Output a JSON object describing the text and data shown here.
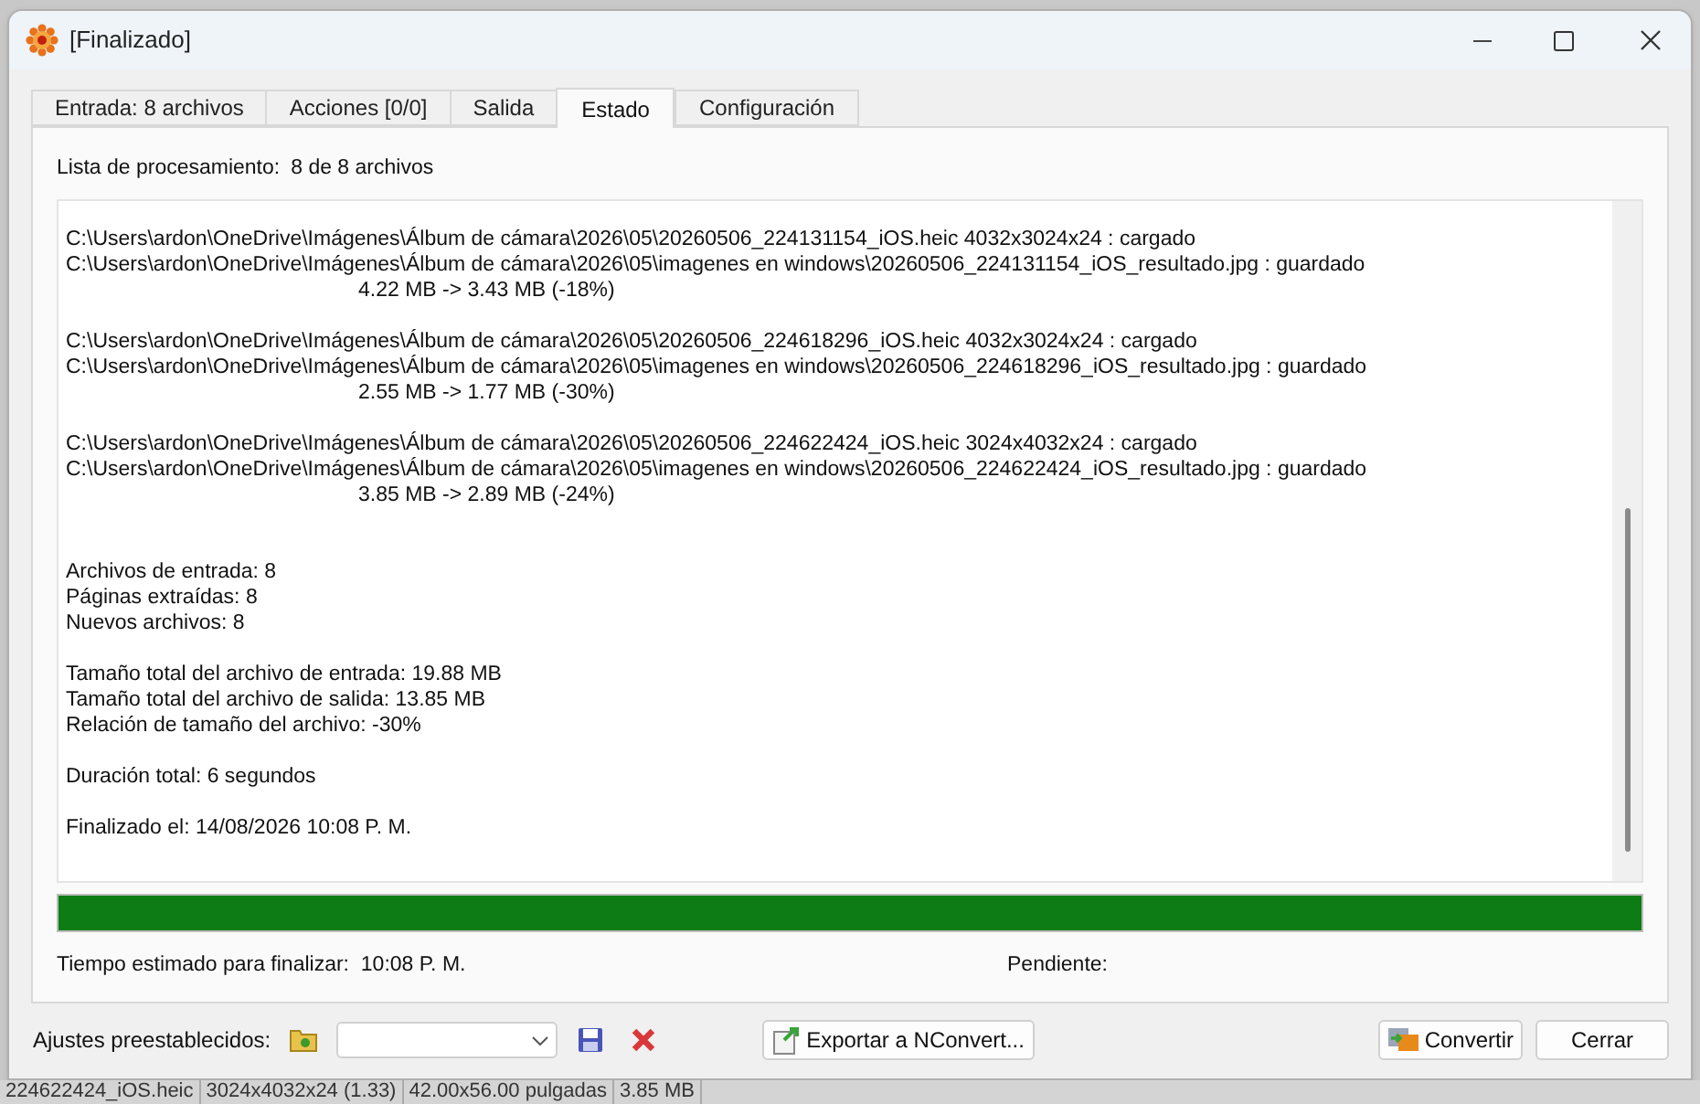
{
  "window": {
    "title": "[Finalizado]"
  },
  "tabs": [
    {
      "label": "Entrada: 8 archivos",
      "selected": false
    },
    {
      "label": "Acciones [0/0]",
      "selected": false
    },
    {
      "label": "Salida",
      "selected": false
    },
    {
      "label": "Estado",
      "selected": true
    },
    {
      "label": "Configuración",
      "selected": false
    }
  ],
  "processing_list": {
    "label": "Lista de procesamiento:",
    "value": "8 de 8 archivos"
  },
  "log": {
    "file_groups": [
      {
        "lines": [
          {
            "kind": "path",
            "text": "C:\\Users\\ardon\\OneDrive\\Imágenes\\Álbum de cámara\\2026\\05\\20260506_224131154_iOS.heic 4032x3024x24 : cargado"
          },
          {
            "kind": "path",
            "text": "C:\\Users\\ardon\\OneDrive\\Imágenes\\Álbum de cámara\\2026\\05\\imagenes en windows\\20260506_224131154_iOS_resultado.jpg : guardado"
          },
          {
            "kind": "size",
            "text": "4.22 MB -> 3.43 MB (-18%)"
          }
        ]
      },
      {
        "lines": [
          {
            "kind": "path",
            "text": "C:\\Users\\ardon\\OneDrive\\Imágenes\\Álbum de cámara\\2026\\05\\20260506_224618296_iOS.heic 4032x3024x24 : cargado"
          },
          {
            "kind": "path",
            "text": "C:\\Users\\ardon\\OneDrive\\Imágenes\\Álbum de cámara\\2026\\05\\imagenes en windows\\20260506_224618296_iOS_resultado.jpg : guardado"
          },
          {
            "kind": "size",
            "text": "2.55 MB -> 1.77 MB (-30%)"
          }
        ]
      },
      {
        "lines": [
          {
            "kind": "path",
            "text": "C:\\Users\\ardon\\OneDrive\\Imágenes\\Álbum de cámara\\2026\\05\\20260506_224622424_iOS.heic 3024x4032x24 : cargado"
          },
          {
            "kind": "path",
            "text": "C:\\Users\\ardon\\OneDrive\\Imágenes\\Álbum de cámara\\2026\\05\\imagenes en windows\\20260506_224622424_iOS_resultado.jpg : guardado"
          },
          {
            "kind": "size",
            "text": "3.85 MB -> 2.89 MB (-24%)"
          }
        ]
      }
    ],
    "summary_groups": [
      [
        "Archivos de entrada: 8",
        "Páginas extraídas: 8",
        "Nuevos archivos: 8"
      ],
      [
        "Tamaño total del archivo de entrada: 19.88 MB",
        "Tamaño total del archivo de salida: 13.85 MB",
        "Relación de tamaño del archivo: -30%"
      ],
      [
        "Duración total: 6 segundos"
      ],
      [
        "Finalizado el: 14/08/2026 10:08 P. M."
      ]
    ]
  },
  "progress": {
    "level": 1
  },
  "estimated_time": "Tiempo estimado para finalizar:  10:08 P. M.",
  "pending": "Pendiente:",
  "presets": {
    "label": "Ajustes preestablecidos:"
  },
  "buttons": {
    "export": "Exportar a NConvert...",
    "convert": "Convertir",
    "close": "Cerrar"
  },
  "background_status_bar": [
    "224622424_iOS.heic",
    "3024x4032x24 (1.33)",
    "42.00x56.00 pulgadas",
    "3.85 MB"
  ]
}
